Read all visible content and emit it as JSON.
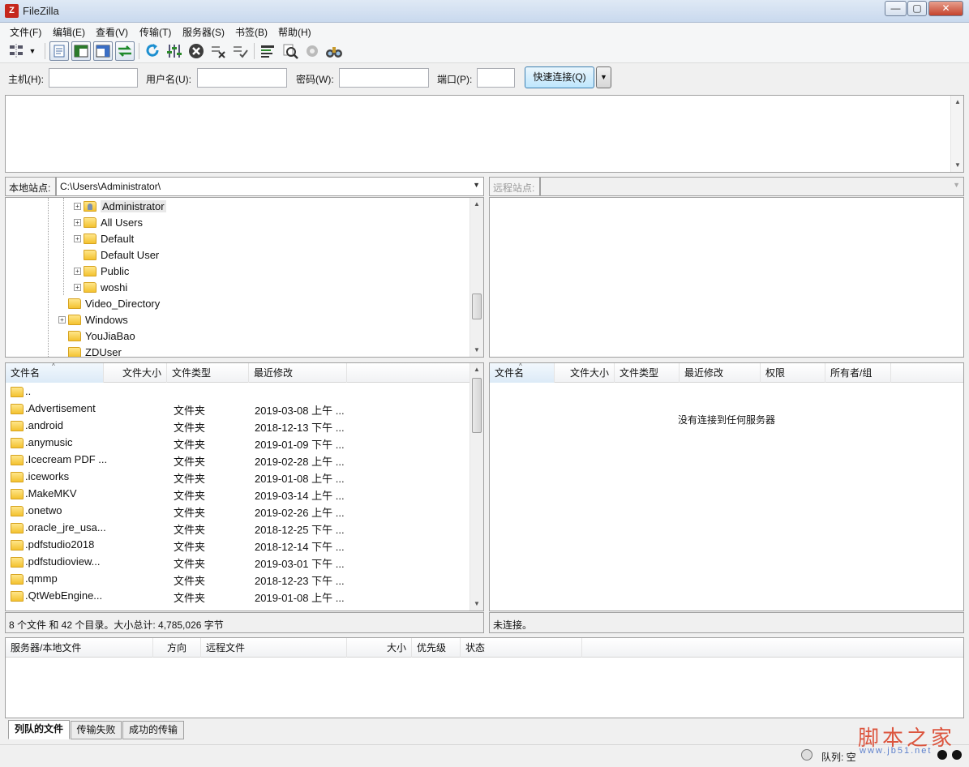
{
  "window": {
    "title": "FileZilla",
    "app_icon_glyph": "Z"
  },
  "window_buttons": {
    "minimize": "—",
    "maximize": "▢",
    "close": "✕"
  },
  "menu": [
    "文件(F)",
    "编辑(E)",
    "查看(V)",
    "传输(T)",
    "服务器(S)",
    "书签(B)",
    "帮助(H)"
  ],
  "toolbar": {
    "icons": [
      "site-manager-icon",
      "dropdown-arrow-icon",
      "toggle-message-log-icon",
      "toggle-local-tree-icon",
      "toggle-remote-tree-icon",
      "toggle-queue-icon",
      "refresh-icon",
      "process-queue-icon",
      "cancel-icon",
      "disconnect-icon",
      "reconnect-icon",
      "directory-filter-icon",
      "directory-comparison-icon",
      "sync-browsing-icon",
      "search-files-icon"
    ]
  },
  "quickconnect": {
    "host_label": "主机(H):",
    "host_value": "",
    "user_label": "用户名(U):",
    "user_value": "",
    "pass_label": "密码(W):",
    "pass_value": "",
    "port_label": "端口(P):",
    "port_value": "",
    "connect_label": "快速连接(Q)",
    "dropdown_glyph": "▼"
  },
  "local": {
    "site_label": "本地站点:",
    "path": "C:\\Users\\Administrator\\",
    "tree": [
      {
        "label": "Administrator",
        "expander": "+",
        "level": "child",
        "icon": "user-folder"
      },
      {
        "label": "All Users",
        "expander": "+",
        "level": "child"
      },
      {
        "label": "Default",
        "expander": "+",
        "level": "child"
      },
      {
        "label": "Default User",
        "expander": "",
        "level": "child"
      },
      {
        "label": "Public",
        "expander": "+",
        "level": "child"
      },
      {
        "label": "woshi",
        "expander": "+",
        "level": "child"
      },
      {
        "label": "Video_Directory",
        "expander": "",
        "level": "parent"
      },
      {
        "label": "Windows",
        "expander": "+",
        "level": "parent"
      },
      {
        "label": "YouJiaBao",
        "expander": "",
        "level": "parent"
      },
      {
        "label": "ZDUser",
        "expander": "",
        "level": "parent"
      }
    ],
    "columns": [
      "文件名",
      "文件大小",
      "文件类型",
      "最近修改"
    ],
    "files": [
      {
        "name": "..",
        "size": "",
        "type": "",
        "modified": ""
      },
      {
        "name": ".Advertisement",
        "size": "",
        "type": "文件夹",
        "modified": "2019-03-08 上午 ..."
      },
      {
        "name": ".android",
        "size": "",
        "type": "文件夹",
        "modified": "2018-12-13 下午 ..."
      },
      {
        "name": ".anymusic",
        "size": "",
        "type": "文件夹",
        "modified": "2019-01-09 下午 ..."
      },
      {
        "name": ".Icecream PDF ...",
        "size": "",
        "type": "文件夹",
        "modified": "2019-02-28 上午 ..."
      },
      {
        "name": ".iceworks",
        "size": "",
        "type": "文件夹",
        "modified": "2019-01-08 上午 ..."
      },
      {
        "name": ".MakeMKV",
        "size": "",
        "type": "文件夹",
        "modified": "2019-03-14 上午 ..."
      },
      {
        "name": ".onetwo",
        "size": "",
        "type": "文件夹",
        "modified": "2019-02-26 上午 ..."
      },
      {
        "name": ".oracle_jre_usa...",
        "size": "",
        "type": "文件夹",
        "modified": "2018-12-25 下午 ..."
      },
      {
        "name": ".pdfstudio2018",
        "size": "",
        "type": "文件夹",
        "modified": "2018-12-14 下午 ..."
      },
      {
        "name": ".pdfstudioview...",
        "size": "",
        "type": "文件夹",
        "modified": "2019-03-01 下午 ..."
      },
      {
        "name": ".qmmp",
        "size": "",
        "type": "文件夹",
        "modified": "2018-12-23 下午 ..."
      },
      {
        "name": ".QtWebEngine...",
        "size": "",
        "type": "文件夹",
        "modified": "2019-01-08 上午 ..."
      }
    ],
    "status": "8 个文件 和 42 个目录。大小总计: 4,785,026 字节"
  },
  "remote": {
    "site_label": "远程站点:",
    "path": "",
    "columns": [
      "文件名",
      "文件大小",
      "文件类型",
      "最近修改",
      "权限",
      "所有者/组"
    ],
    "empty_message": "没有连接到任何服务器",
    "status": "未连接。"
  },
  "queue": {
    "columns": [
      "服务器/本地文件",
      "方向",
      "远程文件",
      "大小",
      "优先级",
      "状态"
    ],
    "tabs": [
      "列队的文件",
      "传输失败",
      "成功的传输"
    ],
    "active_tab": 0,
    "status_label": "队列: 空"
  },
  "watermark": {
    "logo_text": "脚本之家",
    "url_text": "www.jb51.net"
  }
}
